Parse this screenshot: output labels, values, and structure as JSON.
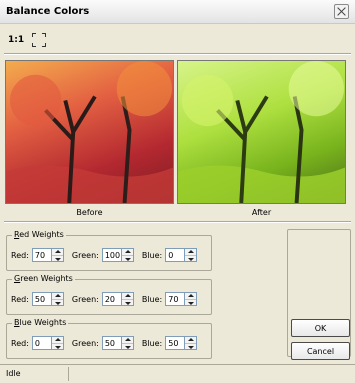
{
  "window": {
    "title": "Balance Colors",
    "close_icon": "close-icon"
  },
  "toolbar": {
    "actual_size_label": "1:1",
    "fit_icon": "fit-to-window-icon"
  },
  "preview": {
    "before_caption": "Before",
    "after_caption": "After"
  },
  "groups": [
    {
      "title_accel": "R",
      "title_rest": "ed Weights",
      "red_label": "Red:",
      "green_label": "Green:",
      "blue_label": "Blue:",
      "red": "70",
      "green": "100",
      "blue": "0"
    },
    {
      "title_accel": "G",
      "title_rest": "reen Weights",
      "red_label": "Red:",
      "green_label": "Green:",
      "blue_label": "Blue:",
      "red": "50",
      "green": "20",
      "blue": "70"
    },
    {
      "title_accel": "B",
      "title_rest": "lue Weights",
      "red_label": "Red:",
      "green_label": "Green:",
      "blue_label": "Blue:",
      "red": "0",
      "green": "50",
      "blue": "50"
    }
  ],
  "buttons": {
    "ok": "OK",
    "cancel": "Cancel"
  },
  "status": {
    "text": "Idle"
  }
}
